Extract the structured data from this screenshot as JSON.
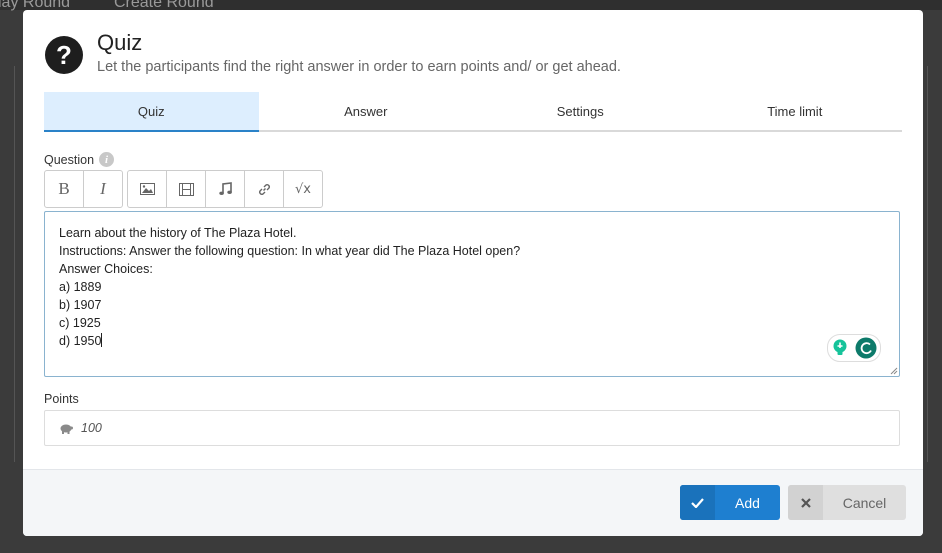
{
  "background": {
    "tabs": [
      "lay Round",
      "Create Round"
    ]
  },
  "modal": {
    "title": "Quiz",
    "subtitle": "Let the participants find the right answer in order to earn points and/ or get ahead.",
    "tabs": [
      {
        "label": "Quiz",
        "active": true
      },
      {
        "label": "Answer",
        "active": false
      },
      {
        "label": "Settings",
        "active": false
      },
      {
        "label": "Time limit",
        "active": false
      }
    ],
    "question": {
      "label": "Question",
      "toolbar": {
        "bold": "B",
        "italic": "I",
        "items": [
          "image-icon",
          "video-icon",
          "music-icon",
          "link-icon",
          "formula-icon"
        ],
        "formula": "√x"
      },
      "lines": [
        "Learn about the history of The Plaza Hotel.",
        "Instructions: Answer the following question: In what year did The Plaza Hotel open?",
        "Answer Choices:",
        "a) 1889",
        "b) 1907",
        "c) 1925",
        "d) 1950"
      ]
    },
    "points": {
      "label": "Points",
      "value": "100",
      "icon": "piggy-bank-icon"
    },
    "footer": {
      "add_label": "Add",
      "cancel_label": "Cancel"
    }
  },
  "colors": {
    "accent": "#1e7fd0",
    "tab_active_bg": "#ddeefe",
    "grammar_green": "#15c39a",
    "grammar_teal": "#0d7a6a"
  }
}
